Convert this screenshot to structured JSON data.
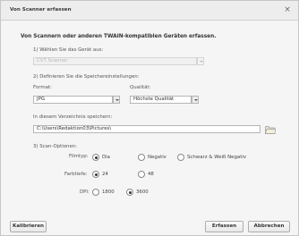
{
  "title": "Von Scanner erfassen",
  "close_glyph": "×",
  "heading": "Von Scannern oder anderen TWAIN-kompatiblen Geräten erfassen.",
  "step1": {
    "label": "1) Wählen Sie das Gerät aus:",
    "device_value": "CVT Scanner"
  },
  "step2": {
    "label": "2) Definieren Sie die Speichereinstellungen:",
    "format_label": "Format:",
    "format_value": "JPG",
    "quality_label": "Qualität:",
    "quality_value": "Höchste Qualität",
    "dir_label": "In diesem Verzeichnis speichern:",
    "dir_value": "C:\\Users\\Redaktion03\\Pictures\\"
  },
  "step3": {
    "label": "3) Scan-Optionen:",
    "filmtyp_label": "Filmtyp:",
    "filmtyp_options": [
      "Dia",
      "Negativ",
      "Schwarz & Weiß Negativ"
    ],
    "filmtyp_selected": "Dia",
    "farbtiefe_label": "Farbtiefe:",
    "farbtiefe_options": [
      "24",
      "48"
    ],
    "farbtiefe_selected": "24",
    "dpi_label": "DPI:",
    "dpi_options": [
      "1800",
      "3600"
    ],
    "dpi_selected": "3600"
  },
  "buttons": {
    "calibrate": "Kalibrieren",
    "capture": "Erfassen",
    "cancel": "Abbrechen"
  },
  "icons": {
    "close": "close-icon",
    "folder": "folder-icon"
  }
}
